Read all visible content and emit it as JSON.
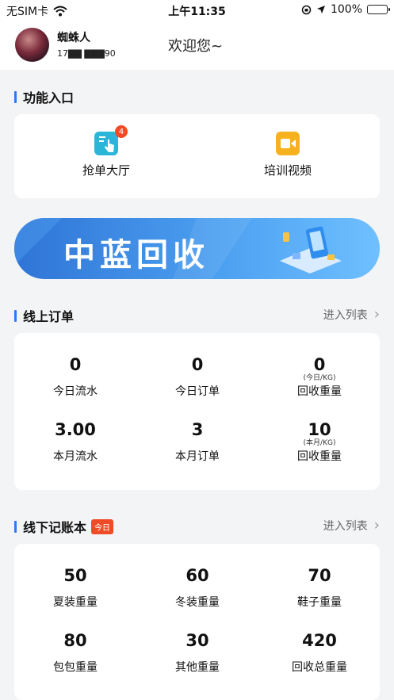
{
  "status_bar": {
    "carrier": "无SIM卡",
    "time": "上午11:35",
    "battery": "100%",
    "battery_level": 1.0
  },
  "header": {
    "user_name": "蜘蛛人",
    "phone_masked": "17▇▇  ▇▇▇90",
    "welcome": "欢迎您~"
  },
  "functions": {
    "title": "功能入口",
    "items": [
      {
        "label": "抢单大厅",
        "badge": "4",
        "icon": "hand-tap-icon",
        "color": "#2bb6d9"
      },
      {
        "label": "培训视频",
        "icon": "video-camera-icon",
        "color": "#f6b21e"
      }
    ]
  },
  "banner": {
    "text": "中蓝回收"
  },
  "online_orders": {
    "title": "线上订单",
    "link": "进入列表",
    "stats": [
      {
        "value": "0",
        "unit": "",
        "label": "今日流水"
      },
      {
        "value": "0",
        "unit": "",
        "label": "今日订单"
      },
      {
        "value": "0",
        "unit": "(今日/KG)",
        "label": "回收重量"
      },
      {
        "value": "3.00",
        "unit": "",
        "label": "本月流水"
      },
      {
        "value": "3",
        "unit": "",
        "label": "本月订单"
      },
      {
        "value": "10",
        "unit": "(本月/KG)",
        "label": "回收重量"
      }
    ]
  },
  "offline_book": {
    "title": "线下记账本",
    "badge": "今日",
    "link": "进入列表",
    "stats": [
      {
        "value": "50",
        "unit": "",
        "label": "夏装重量"
      },
      {
        "value": "60",
        "unit": "",
        "label": "冬装重量"
      },
      {
        "value": "70",
        "unit": "",
        "label": "鞋子重量"
      },
      {
        "value": "80",
        "unit": "",
        "label": "包包重量"
      },
      {
        "value": "30",
        "unit": "",
        "label": "其他重量"
      },
      {
        "value": "420",
        "unit": "",
        "label": "回收总重量"
      }
    ]
  },
  "colors": {
    "accent": "#2d7bf3",
    "badge": "#ef4b26",
    "background": "#f3f4f6"
  }
}
